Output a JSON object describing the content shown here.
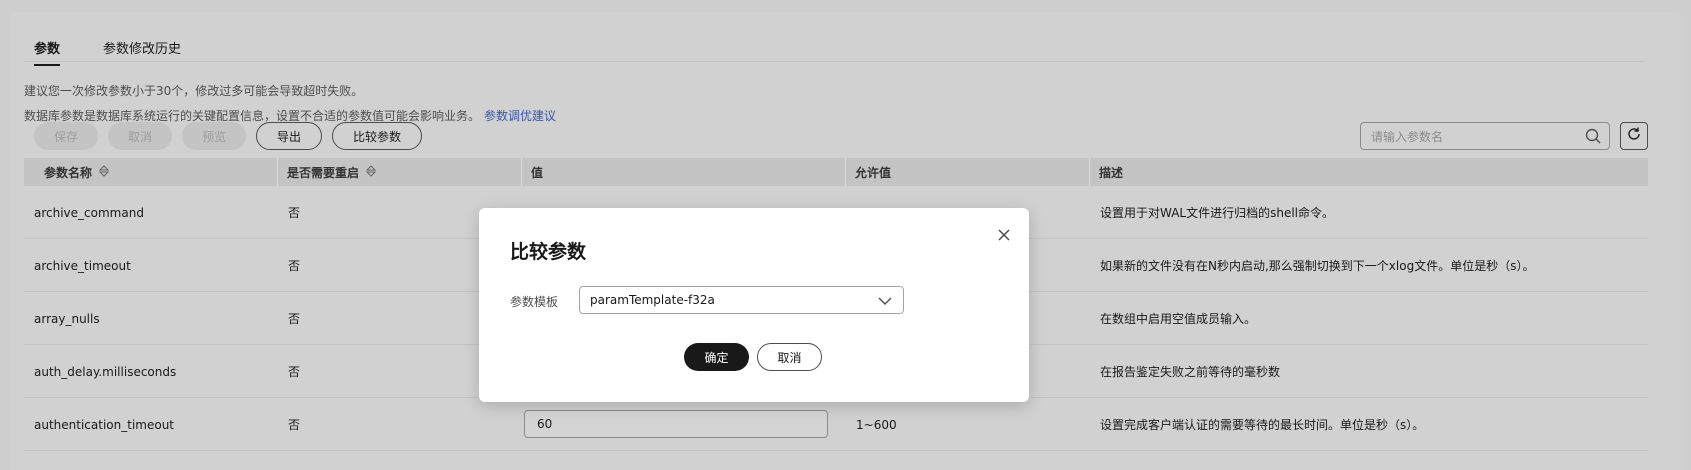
{
  "tabs": [
    {
      "label": "参数",
      "active": true
    },
    {
      "label": "参数修改历史",
      "active": false
    }
  ],
  "tips": {
    "line1": "建议您一次修改参数小于30个，修改过多可能会导致超时失败。",
    "line2": "数据库参数是数据库系统运行的关键配置信息，设置不合适的参数值可能会影响业务。",
    "link": "参数调优建议"
  },
  "toolbar": {
    "save": "保存",
    "cancel": "取消",
    "preview": "预览",
    "export": "导出",
    "compare": "比较参数"
  },
  "search": {
    "placeholder": "请输入参数名"
  },
  "table": {
    "headers": [
      "参数名称",
      "是否需要重启",
      "值",
      "允许值",
      "描述"
    ],
    "rows": [
      {
        "name": "archive_command",
        "restart": "否",
        "value": "",
        "allowed": "",
        "desc": "设置用于对WAL文件进行归档的shell命令。"
      },
      {
        "name": "archive_timeout",
        "restart": "否",
        "value": "",
        "allowed": "",
        "desc": "如果新的文件没有在N秒内启动,那么强制切换到下一个xlog文件。单位是秒（s）。"
      },
      {
        "name": "array_nulls",
        "restart": "否",
        "value": "",
        "allowed": "",
        "desc": "在数组中启用空值成员输入。"
      },
      {
        "name": "auth_delay.milliseconds",
        "restart": "否",
        "value": "",
        "allowed": "",
        "desc": "在报告鉴定失败之前等待的毫秒数"
      },
      {
        "name": "authentication_timeout",
        "restart": "否",
        "value": "60",
        "allowed": "1~600",
        "desc": "设置完成客户端认证的需要等待的最长时间。单位是秒（s）。"
      }
    ]
  },
  "modal": {
    "title": "比较参数",
    "field_label": "参数模板",
    "selected_template": "paramTemplate-f32a",
    "confirm": "确定",
    "cancel": "取消"
  },
  "colors": {
    "primary": "#191919",
    "link": "#3a57a8",
    "overlay": "#cfcfcf"
  }
}
